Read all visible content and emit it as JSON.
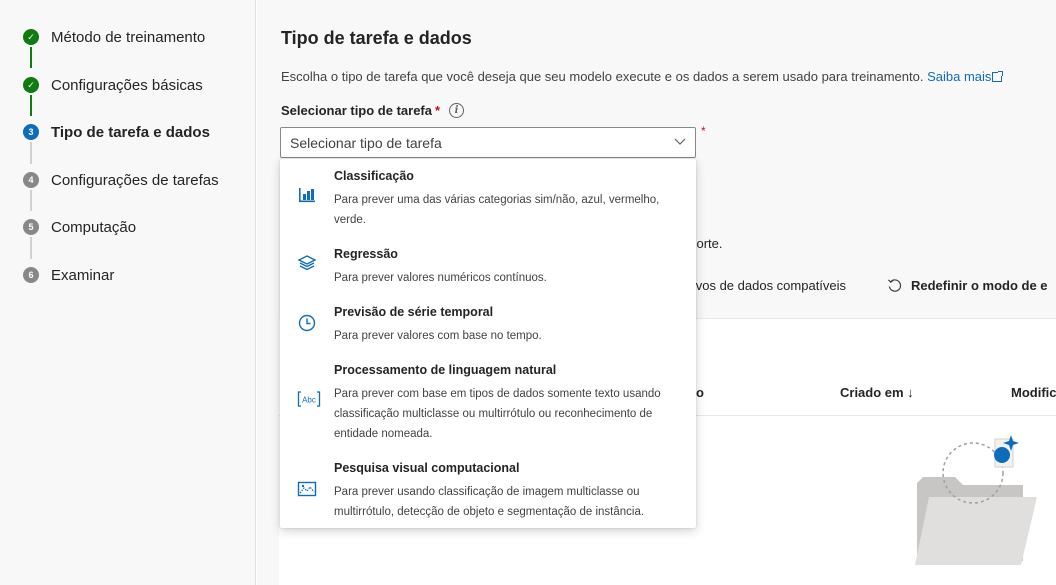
{
  "wizard": {
    "steps": [
      {
        "label": "Método de treinamento",
        "badge": "✓",
        "status": "done"
      },
      {
        "label": "Configurações básicas",
        "badge": "✓",
        "status": "done"
      },
      {
        "label": "Tipo de tarefa e dados",
        "badge": "3",
        "status": "current"
      },
      {
        "label": "Configurações de tarefas",
        "badge": "4",
        "status": "todo"
      },
      {
        "label": "Computação",
        "badge": "5",
        "status": "todo"
      },
      {
        "label": "Examinar",
        "badge": "6",
        "status": "todo"
      }
    ]
  },
  "main": {
    "title": "Tipo de tarefa e dados",
    "description": "Escolha o tipo de tarefa que você deseja que seu modelo execute e os dados a serem usado para treinamento.",
    "learn_more": "Saiba mais",
    "task_type_label": "Selecionar tipo de tarefa",
    "required_mark": "*",
    "info_glyph": "i",
    "dropdown_placeholder": "Selecionar tipo de tarefa",
    "bg_support_text": "uporte.",
    "bg_filter_text": "ativos de dados compatíveis",
    "reset_label": "Redefinir o modo de e",
    "col_fragment": "o",
    "col_created": "Criado em ↓",
    "col_modified": "Modific"
  },
  "menu": {
    "options": [
      {
        "title": "Classificação",
        "desc": "Para prever uma das várias categorias sim/não, azul, vermelho, verde.",
        "icon": "bar-chart-icon"
      },
      {
        "title": "Regressão",
        "desc": "Para prever valores numéricos contínuos.",
        "icon": "layers-icon"
      },
      {
        "title": "Previsão de série temporal",
        "desc": "Para prever valores com base no tempo.",
        "icon": "clock-icon"
      },
      {
        "title": "Processamento de linguagem natural",
        "desc": "Para prever com base em tipos de dados somente texto usando classificação multiclasse ou multirrótulo ou reconhecimento de entidade nomeada.",
        "icon": "text-abc-icon",
        "icon_text": "Abc"
      },
      {
        "title": "Pesquisa visual computacional",
        "desc": "Para prever usando classificação de imagem multiclasse ou multirrótulo, detecção de objeto e segmentação de instância.",
        "icon": "image-icon"
      }
    ]
  },
  "colors": {
    "accent": "#0f6cbd",
    "done": "#107c10",
    "todo": "#8a8886",
    "required": "#c50f1f"
  }
}
